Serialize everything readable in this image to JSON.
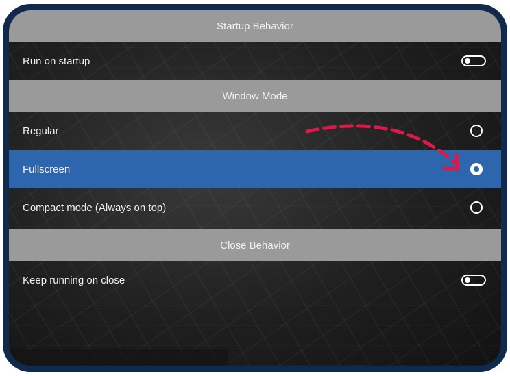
{
  "sections": {
    "startup": {
      "header": "Startup Behavior",
      "run_on_startup": {
        "label": "Run on startup",
        "enabled": false
      }
    },
    "window_mode": {
      "header": "Window Mode",
      "options": [
        {
          "label": "Regular",
          "selected": false
        },
        {
          "label": "Fullscreen",
          "selected": true
        },
        {
          "label": "Compact mode (Always on top)",
          "selected": false
        }
      ]
    },
    "close": {
      "header": "Close Behavior",
      "keep_running": {
        "label": "Keep running on close",
        "enabled": false
      }
    }
  },
  "colors": {
    "frame": "#0f2a4a",
    "header": "#9a9a9a",
    "selected_row": "#2e66ad",
    "annotation_arrow": "#d81b4a"
  },
  "icons": {
    "toggle": "toggle-off-icon",
    "radio_unchecked": "radio-unchecked-icon",
    "radio_checked": "radio-checked-icon",
    "annotation": "dashed-curved-arrow"
  }
}
